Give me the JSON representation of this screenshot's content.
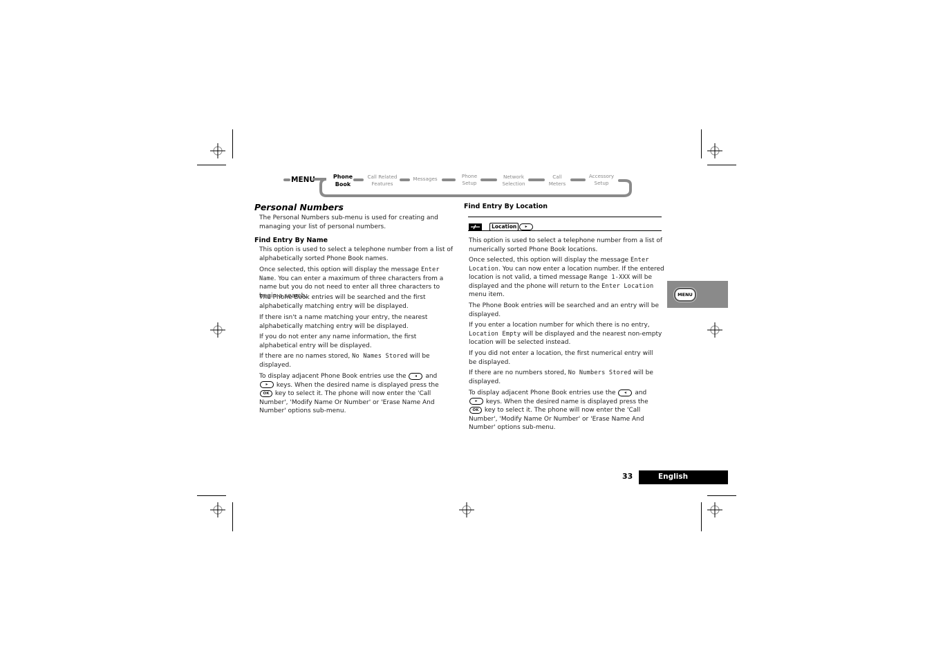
{
  "menu_nav": {
    "menu_label": "MENU",
    "items": [
      {
        "label": "Phone\nBook",
        "active": true
      },
      {
        "label": "Call Related\nFeatures",
        "active": false
      },
      {
        "label": "Messages",
        "active": false
      },
      {
        "label": "Phone\nSetup",
        "active": false
      },
      {
        "label": "Network\nSelection",
        "active": false
      },
      {
        "label": "Call\nMeters",
        "active": false
      },
      {
        "label": "Accessory\nSetup",
        "active": false
      }
    ]
  },
  "left_column": {
    "title": "Personal Numbers",
    "intro": "The Personal Numbers sub-menu is used for creating and managing your list of personal numbers.",
    "subtitle": "Find Entry By Name",
    "p1": "This option is used to select a telephone number from a list of alphabetically sorted Phone Book names.",
    "p2_a": "Once selected, this option will display the message ",
    "p2_code": "Enter Name",
    "p2_b": ". You can enter a maximum of three characters from a name but you do not need to enter all three characters to begin a search.",
    "p3": "The Phone Book entries will be searched and the first alphabetically matching entry will be displayed.",
    "p4": "If there isn't a name matching your entry, the nearest alphabetically matching entry will be displayed.",
    "p5": "If you do not enter any name information, the first alphabetical entry will be displayed.",
    "p6_a": "If there are no names stored, ",
    "p6_code": "No Names Stored",
    "p6_b": " will be displayed.",
    "p7_a": "To display adjacent Phone Book entries use the ",
    "p7_and": " and ",
    "p7_b": " keys. When the desired name is displayed press the ",
    "p7_c": " key to select it. The phone will now enter the 'Call Number', 'Modify Name Or Number' or 'Erase Name And Number' options sub-menu."
  },
  "right_column": {
    "subtitle": "Find Entry By Location",
    "shortcut_key": "Location",
    "p1": "This option is used to select a telephone number from a list of numerically sorted Phone Book locations.",
    "p2_a": "Once selected, this option will display the message ",
    "p2_code1": "Enter Location",
    "p2_b": ". You can now enter a location number. If the entered location is not valid, a timed message ",
    "p2_code2": "Range 1-XXX",
    "p2_c": " will be displayed and the phone will return to the ",
    "p2_code3": "Enter Location",
    "p2_d": " menu item.",
    "p3": "The Phone Book entries will be searched and an entry will be displayed.",
    "p4_a": "If you enter a location number for which there is no entry, ",
    "p4_code": "Location Empty",
    "p4_b": " will be displayed and the nearest non-empty location will be selected instead.",
    "p5": "If you did not enter a location, the first numerical entry will be displayed.",
    "p6_a": "If there are no numbers stored, ",
    "p6_code": "No Numbers Stored",
    "p6_b": " will be displayed.",
    "p7_a": "To display adjacent Phone Book entries use the ",
    "p7_and": " and ",
    "p7_b": " keys. When the desired name is displayed press the ",
    "p7_c": " key to select it. The phone will now enter the 'Call Number', 'Modify Name Or Number' or 'Erase Name And Number' options sub-menu."
  },
  "keys": {
    "left": "◂",
    "right": "▸",
    "ok": "OK"
  },
  "side_tab": {
    "label": "MENU"
  },
  "footer": {
    "page_number": "33",
    "language": "English"
  }
}
